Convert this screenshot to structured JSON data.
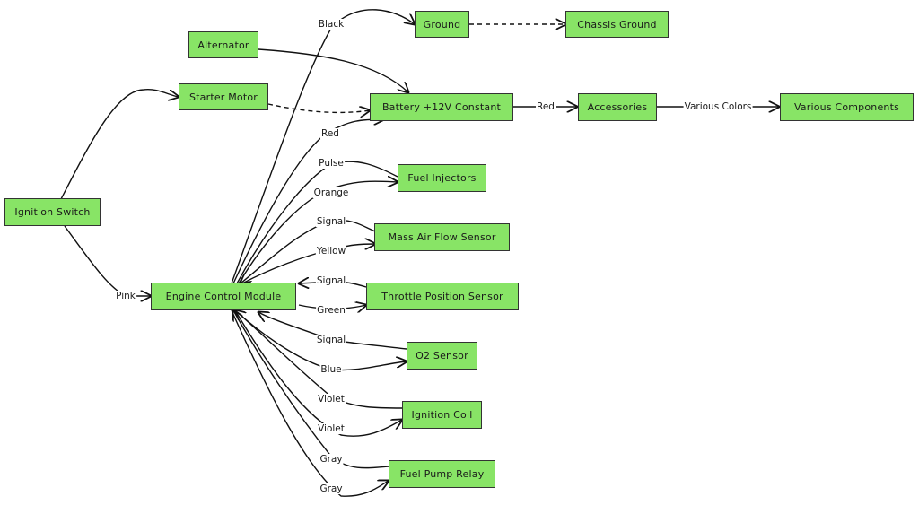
{
  "diagram": {
    "node_fill": "#88e466",
    "nodes": {
      "alternator": "Alternator",
      "starter": "Starter Motor",
      "ignition_switch": "Ignition Switch",
      "ground": "Ground",
      "chassis_ground": "Chassis Ground",
      "battery": "Battery +12V Constant",
      "accessories": "Accessories",
      "various_components": "Various Components",
      "ecm": "Engine Control Module",
      "fuel_injectors": "Fuel Injectors",
      "maf": "Mass Air Flow Sensor",
      "tps": "Throttle Position Sensor",
      "o2": "O2 Sensor",
      "ignition_coil": "Ignition Coil",
      "fuel_pump_relay": "Fuel Pump Relay"
    },
    "edges": [
      {
        "id": "e-black",
        "from": "ecm",
        "to": "ground",
        "label": "Black",
        "style": "solid"
      },
      {
        "id": "e-ground-chassis",
        "from": "ground",
        "to": "chassis_ground",
        "label": "",
        "style": "dashed"
      },
      {
        "id": "e-alt-batt",
        "from": "alternator",
        "to": "battery",
        "label": "",
        "style": "solid"
      },
      {
        "id": "e-starter-batt",
        "from": "starter",
        "to": "battery",
        "label": "",
        "style": "dashed"
      },
      {
        "id": "e-ign-starter",
        "from": "ignition_switch",
        "to": "starter",
        "label": "",
        "style": "solid"
      },
      {
        "id": "e-ecm-batt",
        "from": "ecm",
        "to": "battery",
        "label": "Red",
        "style": "solid"
      },
      {
        "id": "e-batt-acc",
        "from": "battery",
        "to": "accessories",
        "label": "Red",
        "style": "solid"
      },
      {
        "id": "e-acc-comp",
        "from": "accessories",
        "to": "various_components",
        "label": "Various Colors",
        "style": "solid"
      },
      {
        "id": "e-ign-ecm",
        "from": "ignition_switch",
        "to": "ecm",
        "label": "Pink",
        "style": "solid"
      },
      {
        "id": "e-fi-pulse",
        "from": "ecm",
        "to": "fuel_injectors",
        "label": "Pulse",
        "style": "solid"
      },
      {
        "id": "e-fi-orange",
        "from": "ecm",
        "to": "fuel_injectors",
        "label": "Orange",
        "style": "solid"
      },
      {
        "id": "e-maf-signal",
        "from": "maf",
        "to": "ecm",
        "label": "Signal",
        "style": "solid"
      },
      {
        "id": "e-maf-yellow",
        "from": "ecm",
        "to": "maf",
        "label": "Yellow",
        "style": "solid"
      },
      {
        "id": "e-tps-signal",
        "from": "tps",
        "to": "ecm",
        "label": "Signal",
        "style": "solid"
      },
      {
        "id": "e-tps-green",
        "from": "ecm",
        "to": "tps",
        "label": "Green",
        "style": "solid"
      },
      {
        "id": "e-o2-signal",
        "from": "o2",
        "to": "ecm",
        "label": "Signal",
        "style": "solid"
      },
      {
        "id": "e-o2-blue",
        "from": "ecm",
        "to": "o2",
        "label": "Blue",
        "style": "solid"
      },
      {
        "id": "e-coil-violet1",
        "from": "ignition_coil",
        "to": "ecm",
        "label": "Violet",
        "style": "solid"
      },
      {
        "id": "e-coil-violet2",
        "from": "ecm",
        "to": "ignition_coil",
        "label": "Violet",
        "style": "solid"
      },
      {
        "id": "e-relay-gray1",
        "from": "fuel_pump_relay",
        "to": "ecm",
        "label": "Gray",
        "style": "solid"
      },
      {
        "id": "e-relay-gray2",
        "from": "ecm",
        "to": "fuel_pump_relay",
        "label": "Gray",
        "style": "solid"
      }
    ]
  }
}
